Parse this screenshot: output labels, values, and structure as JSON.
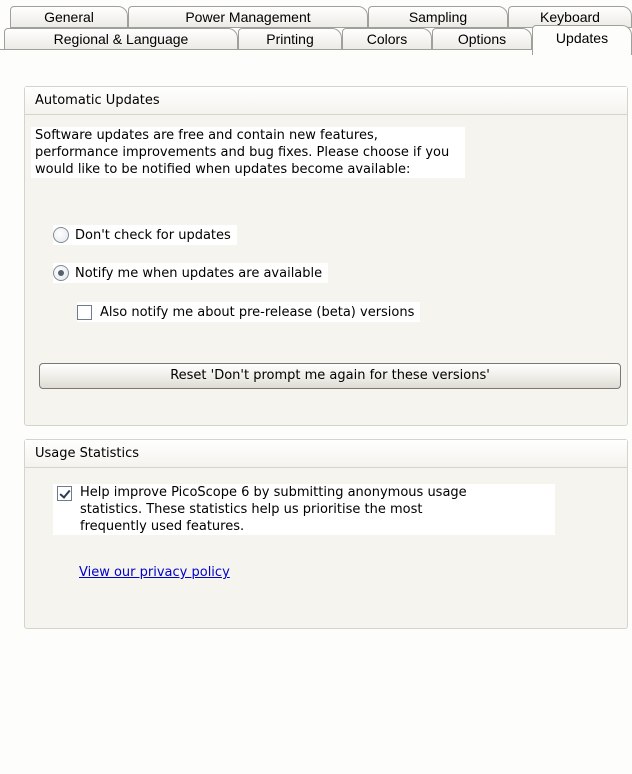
{
  "tabs": {
    "row1": [
      "General",
      "Power Management",
      "Sampling",
      "Keyboard"
    ],
    "row2": [
      "Regional & Language",
      "Printing",
      "Colors",
      "Options",
      "Updates"
    ],
    "active": "Updates"
  },
  "automatic_updates": {
    "title": "Automatic Updates",
    "description_lines": [
      "Software updates are free and contain new features,",
      "performance improvements and bug fixes. Please choose if you",
      "would like to be notified when updates become available:"
    ],
    "options": [
      {
        "label": "Don't check for updates",
        "selected": false
      },
      {
        "label": "Notify me when updates are available",
        "selected": true
      }
    ],
    "beta_checkbox": {
      "label": "Also notify me about pre-release (beta) versions",
      "checked": false
    },
    "reset_button": "Reset 'Don't prompt me again for these versions'"
  },
  "usage_statistics": {
    "title": "Usage Statistics",
    "checkbox": {
      "checked": true,
      "lines": [
        "Help improve PicoScope 6 by submitting anonymous usage",
        "statistics. These statistics help us prioritise the most",
        "frequently used features."
      ]
    },
    "privacy_link": "View our privacy policy"
  }
}
